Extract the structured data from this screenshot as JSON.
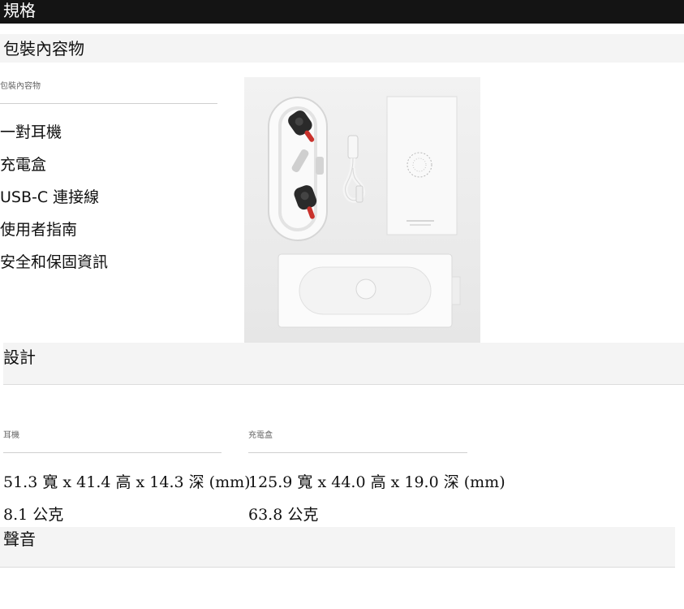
{
  "header": {
    "title": "規格"
  },
  "package": {
    "title": "包裝內容物",
    "label": "包裝內容物",
    "items": [
      "一對耳機",
      "充電盒",
      "USB-C 連接線",
      "使用者指南",
      "安全和保固資訊"
    ]
  },
  "design": {
    "title": "設計",
    "earbuds": {
      "label": "耳機",
      "dimensions": "51.3 寬 x 41.4 高 x 14.3 深 (mm)",
      "weight": "8.1 公克"
    },
    "case": {
      "label": "充電盒",
      "dimensions": "125.9 寬 x 44.0 高 x 19.0 深 (mm)",
      "weight": "63.8 公克"
    }
  },
  "sound": {
    "title": "聲音"
  }
}
